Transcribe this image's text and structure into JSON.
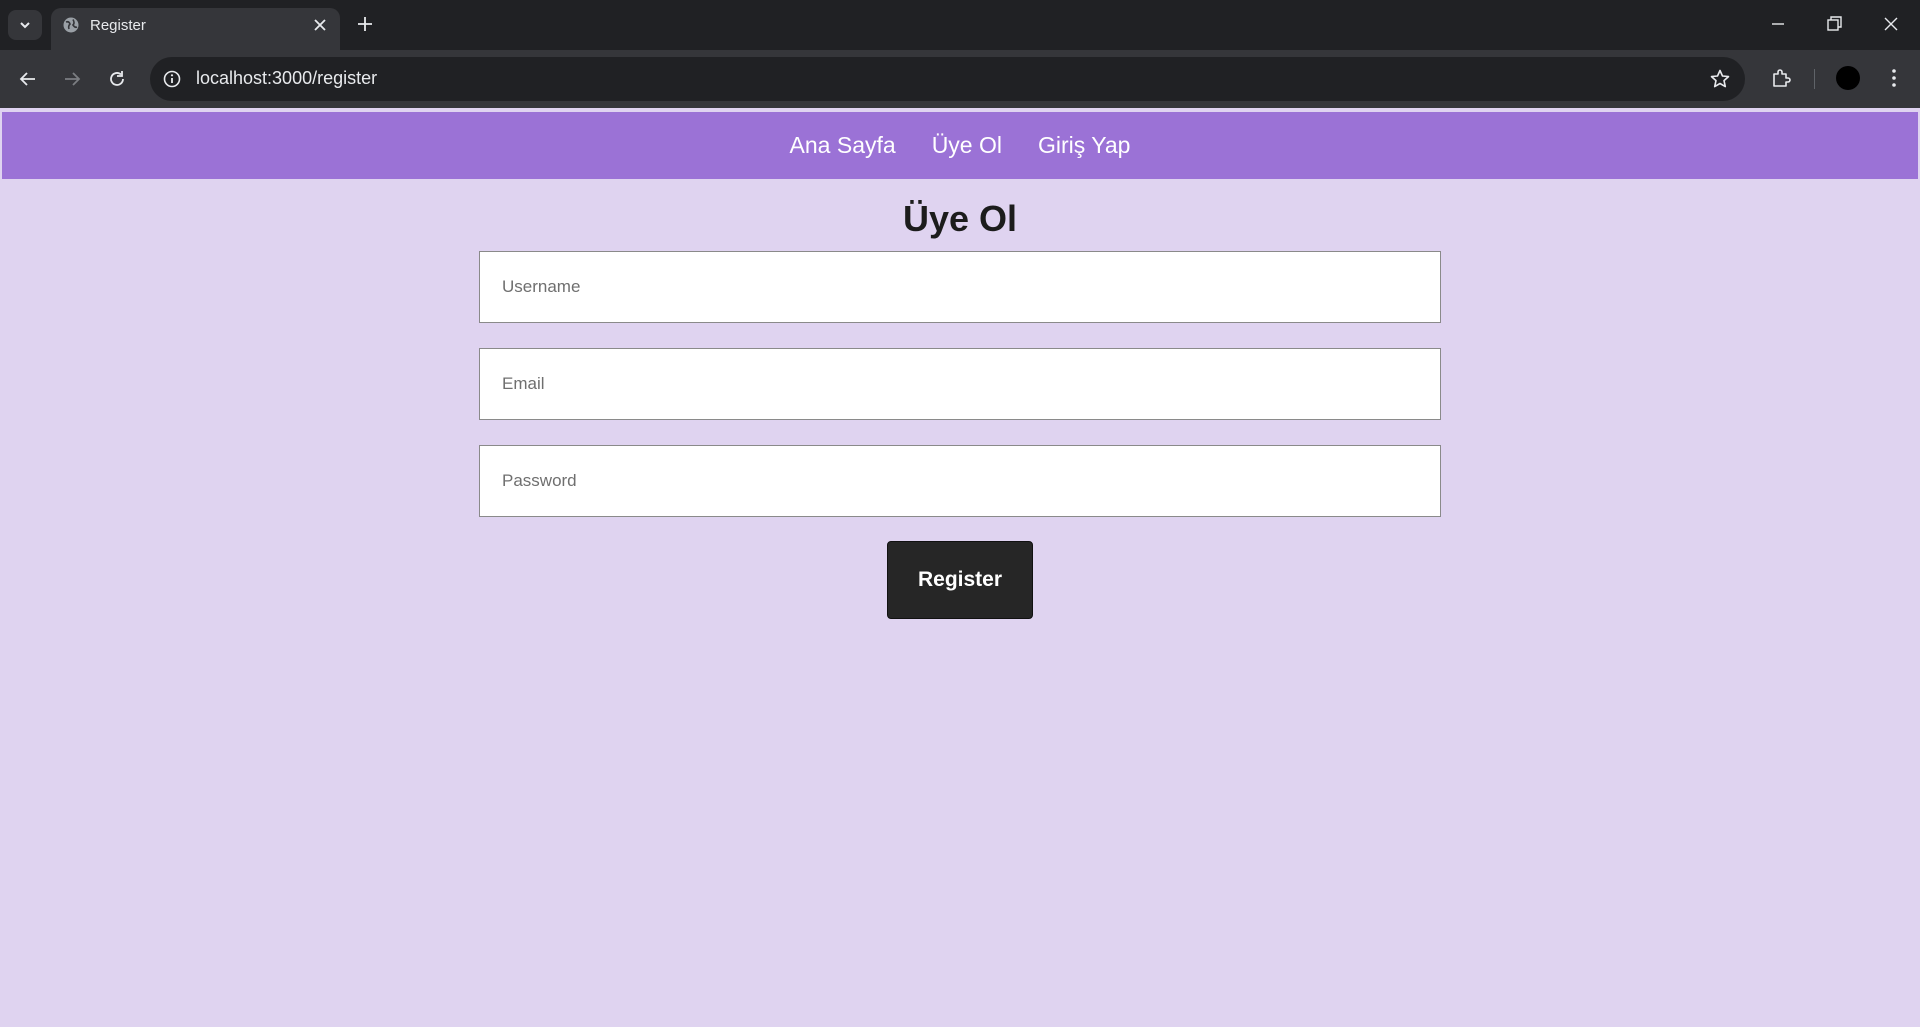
{
  "browser": {
    "tab_title": "Register",
    "url": "localhost:3000/register"
  },
  "nav": {
    "items": [
      "Ana Sayfa",
      "Üye Ol",
      "Giriş Yap"
    ]
  },
  "page": {
    "title": "Üye Ol"
  },
  "form": {
    "username_placeholder": "Username",
    "email_placeholder": "Email",
    "password_placeholder": "Password",
    "submit_label": "Register"
  },
  "colors": {
    "navbar": "#9b72d6",
    "background": "#dfd3f0",
    "button": "#262626"
  },
  "icons": [
    "tab-list-icon",
    "globe-icon",
    "close-icon",
    "plus-icon",
    "minimize-icon",
    "restore-icon",
    "window-close-icon",
    "back-icon",
    "forward-icon",
    "reload-icon",
    "info-icon",
    "star-icon",
    "extensions-icon",
    "profile-avatar",
    "kebab-menu-icon"
  ]
}
